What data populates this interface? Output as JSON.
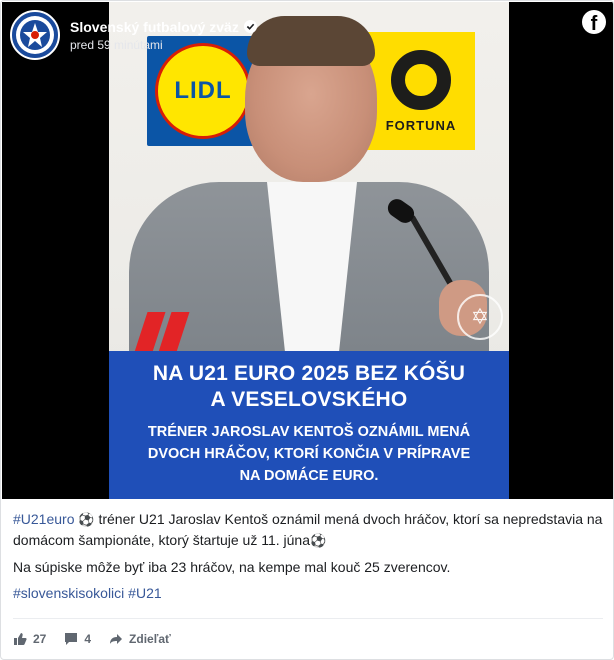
{
  "post": {
    "page_name": "Slovenský futbalový zväz",
    "timestamp": "pred 59 minútami",
    "platform_icon": "facebook-icon",
    "avatar_icon": "sfz-logo-icon"
  },
  "image": {
    "sponsor_left": "LIDL",
    "sponsor_right": "FORTUNA",
    "banner_title_line1": "NA U21 EURO 2025 BEZ KÓŠU",
    "banner_title_line2": "A VESELOVSKÉHO",
    "banner_sub_line1": "TRÉNER JAROSLAV KENTOŠ OZNÁMIL MENÁ",
    "banner_sub_line2": "DVOCH HRÁČOV, KTORÍ KONČIA V PRÍPRAVE",
    "banner_sub_line3": "NA DOMÁCE EURO."
  },
  "text": {
    "hashtag_u21euro": "#U21euro",
    "line1_rest": " tréner U21 Jaroslav Kentoš oznámil mená dvoch hráčov, ktorí sa nepredstavia na domácom šampionáte, ktorý štartuje už 11. júna",
    "soccer_emoji": "⚽",
    "line2": "Na súpiske môže byť iba 23 hráčov, na kempe mal kouč 25 zverencov.",
    "hashtag_sokolici": "#slovenskisokolici",
    "hashtag_u21": "#U21"
  },
  "actions": {
    "likes": "27",
    "comments": "4",
    "share_label": "Zdieľať"
  },
  "colors": {
    "hashtag": "#385898",
    "banner": "#1f4fb8",
    "accent_red": "#e22426"
  }
}
